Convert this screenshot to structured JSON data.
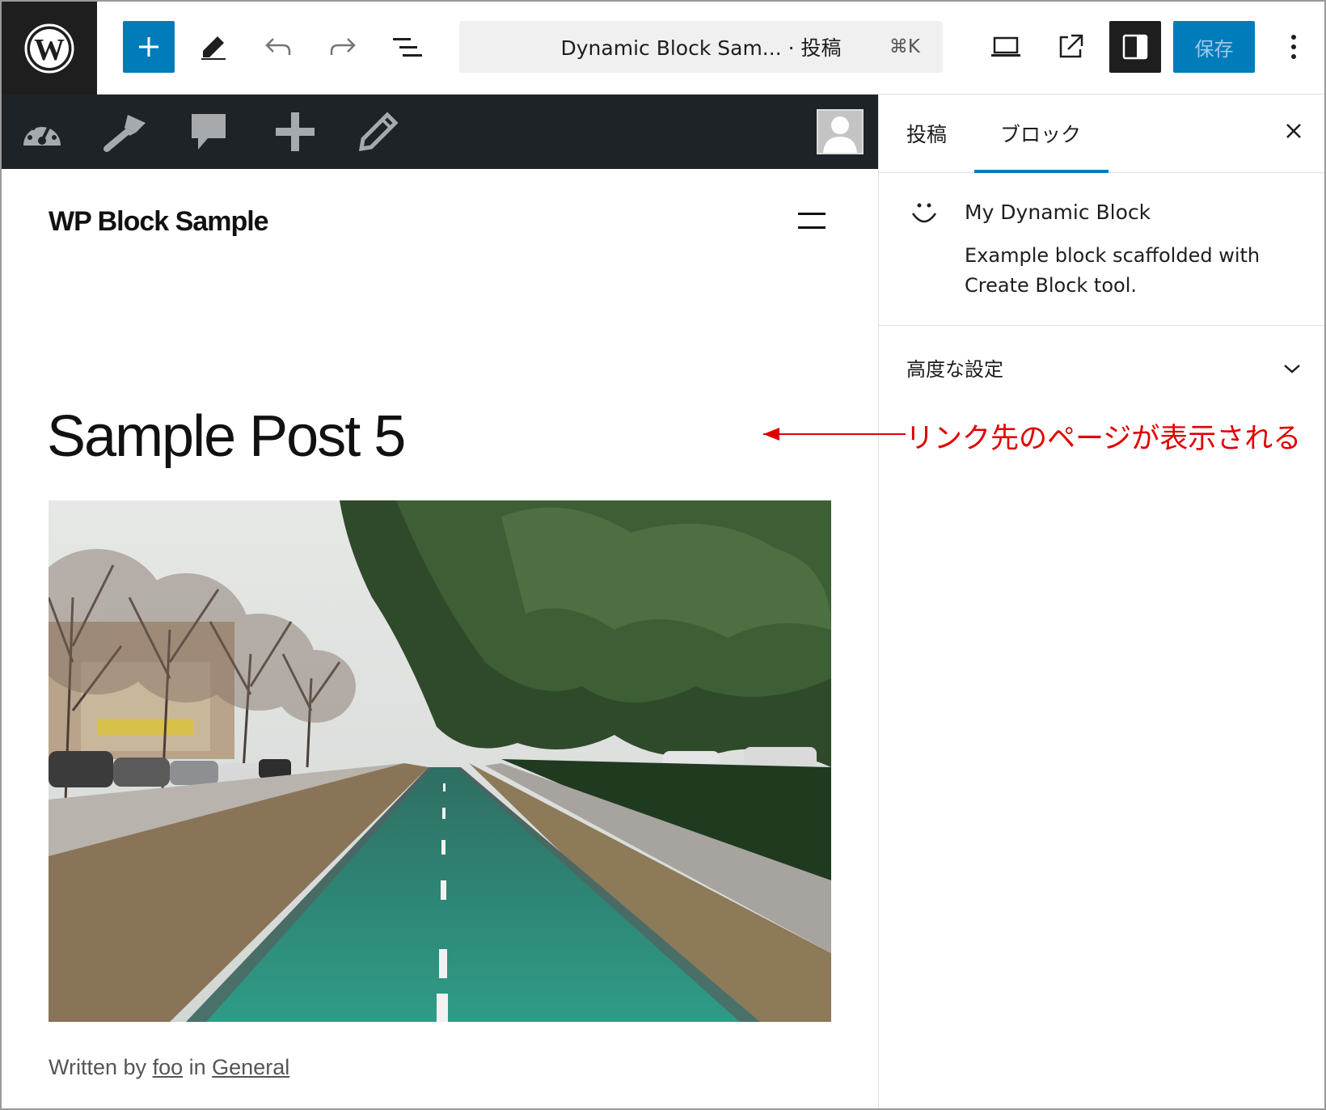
{
  "toolbar": {
    "logo_icon": "wordpress-logo",
    "add_icon": "plus-icon",
    "tools_icon": "pencil-icon",
    "undo_icon": "undo-icon",
    "redo_icon": "redo-icon",
    "list_view_icon": "list-view-icon",
    "document_title": "Dynamic Block Sam... · 投稿",
    "shortcut": "⌘K",
    "preview_icon": "laptop-icon",
    "view_post_icon": "external-link-icon",
    "settings_icon": "sidebar-toggle-icon",
    "save_label": "保存",
    "more_icon": "more-vertical-icon",
    "accent_color": "#007cba"
  },
  "admin_bar": {
    "items": [
      "dashboard-icon",
      "customize-brush-icon",
      "comments-icon",
      "new-plus-icon",
      "edit-pencil-icon"
    ],
    "avatar_icon": "user-avatar"
  },
  "canvas": {
    "site_title": "WP Block Sample",
    "menu_icon": "hamburger-icon",
    "post_title": "Sample Post 5",
    "featured_image": "tree-lined green bike lane photo",
    "byline": {
      "written_by": "Written by",
      "author": "foo",
      "in": "in",
      "category": "General"
    }
  },
  "sidebar": {
    "tabs": [
      {
        "label": "投稿"
      },
      {
        "label": "ブロック"
      }
    ],
    "active_tab": "ブロック",
    "block": {
      "icon": "smiley-icon",
      "name": "My Dynamic Block",
      "description": "Example block scaffolded with Create Block tool."
    },
    "advanced_label": "高度な設定"
  },
  "annotation": {
    "text": "リンク先のページが表示される",
    "color": "#e00000"
  }
}
